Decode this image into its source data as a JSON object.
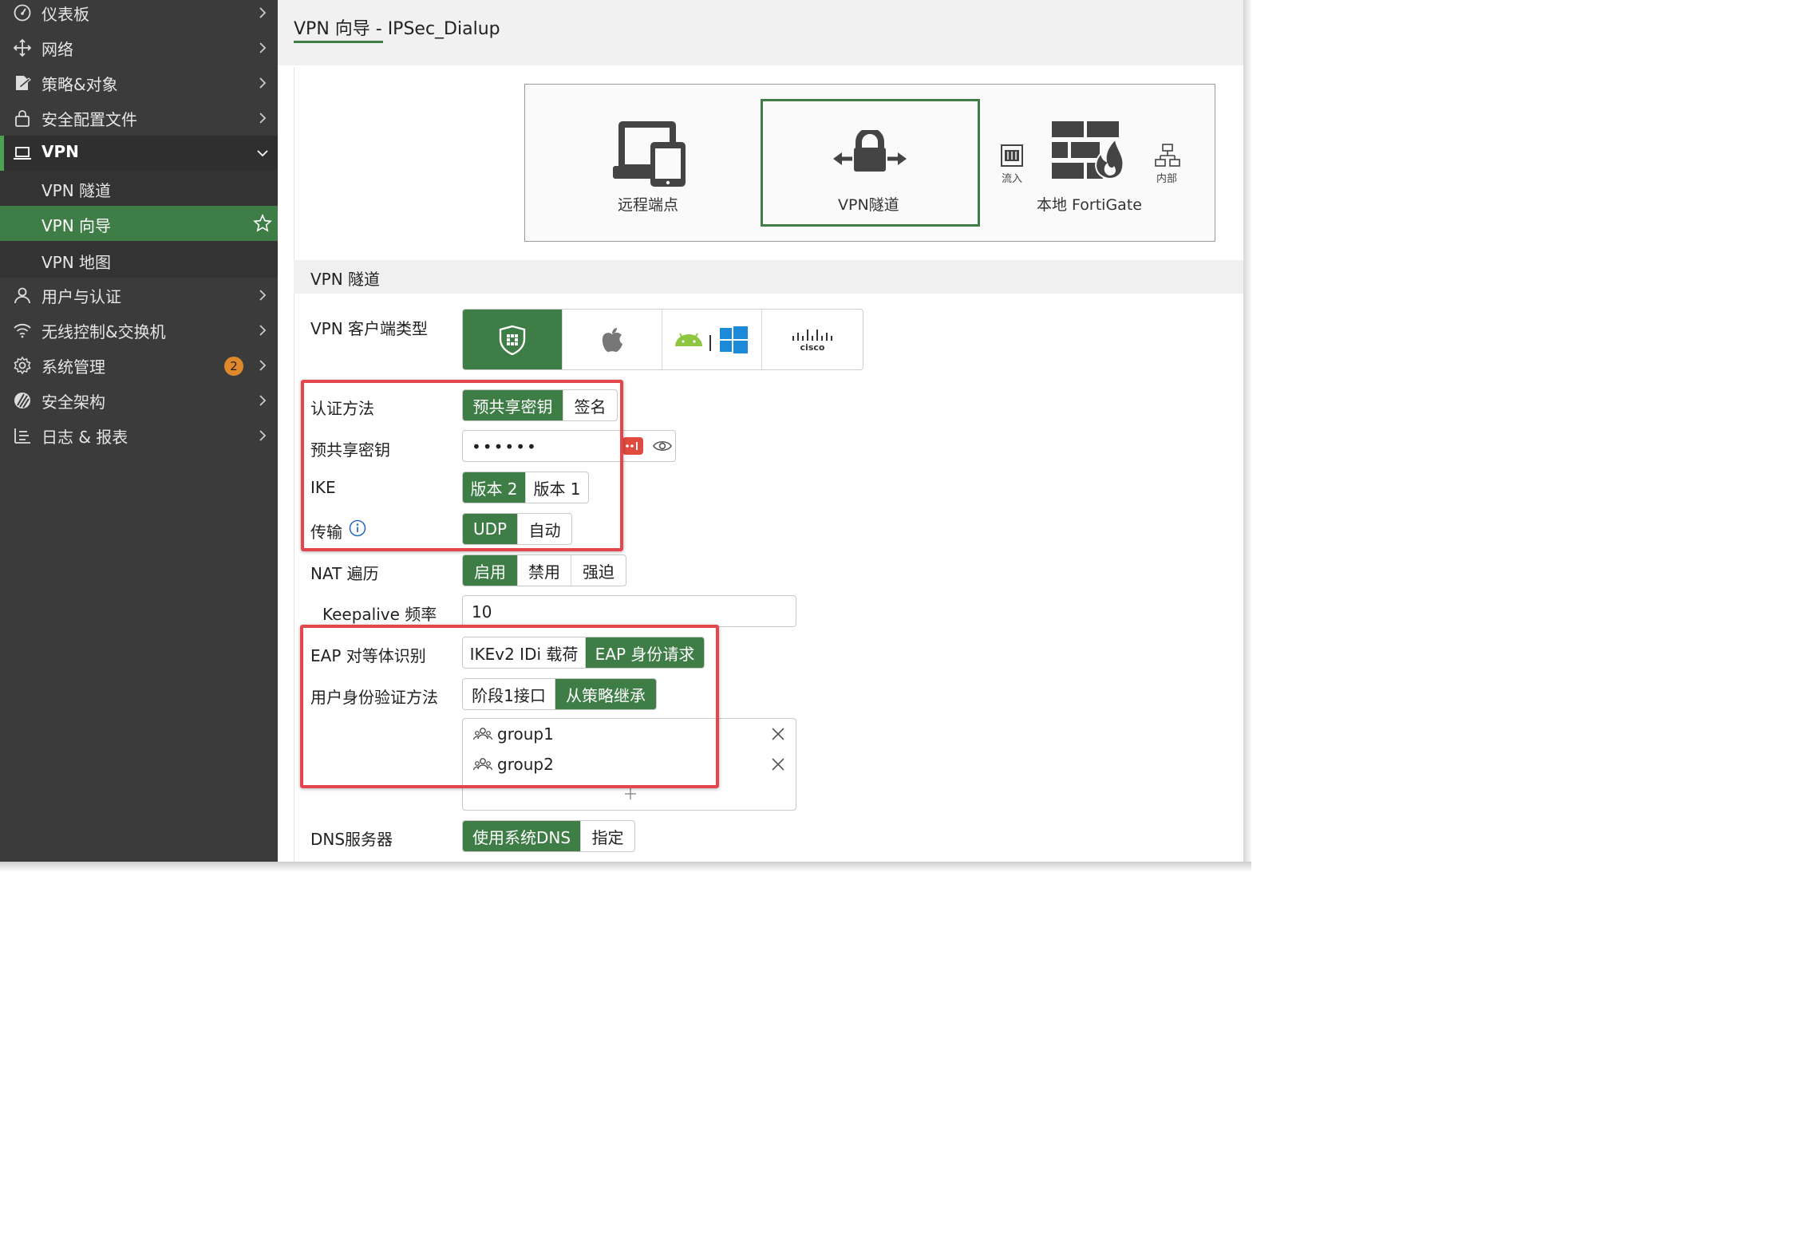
{
  "sidebar": {
    "items": [
      {
        "label": "仪表板",
        "icon": "dashboard-icon"
      },
      {
        "label": "网络",
        "icon": "network-icon"
      },
      {
        "label": "策略&对象",
        "icon": "policy-icon"
      },
      {
        "label": "安全配置文件",
        "icon": "lock-icon"
      },
      {
        "label": "VPN",
        "icon": "laptop-icon"
      },
      {
        "label": "用户与认证",
        "icon": "user-icon"
      },
      {
        "label": "无线控制&交换机",
        "icon": "wifi-icon"
      },
      {
        "label": "系统管理",
        "icon": "gear-icon",
        "badge": "2"
      },
      {
        "label": "安全架构",
        "icon": "security-fabric-icon"
      },
      {
        "label": "日志 & 报表",
        "icon": "log-icon"
      }
    ],
    "vpn_sub": [
      {
        "label": "VPN 隧道"
      },
      {
        "label": "VPN 向导"
      },
      {
        "label": "VPN 地图"
      }
    ]
  },
  "header": {
    "title": "VPN 向导 - IPSec_Dialup"
  },
  "topology": {
    "remote": "远程端点",
    "tunnel": "VPN隧道",
    "local": "本地 FortiGate",
    "inbound": "流入",
    "internal": "内部"
  },
  "section": {
    "title": "VPN 隧道"
  },
  "form": {
    "client_type_label": "VPN 客户端类型",
    "auth_label": "认证方法",
    "auth_options": [
      "预共享密钥",
      "签名"
    ],
    "psk_label": "预共享密钥",
    "psk_value": "••••••",
    "ike_label": "IKE",
    "ike_options": [
      "版本 2",
      "版本 1"
    ],
    "transport_label": "传输",
    "transport_options": [
      "UDP",
      "自动"
    ],
    "nat_label": "NAT 遍历",
    "nat_options": [
      "启用",
      "禁用",
      "强迫"
    ],
    "keepalive_label": "Keepalive 频率",
    "keepalive_value": "10",
    "eap_label": "EAP 对等体识别",
    "eap_options": [
      "IKEv2 IDi 载荷",
      "EAP 身份请求"
    ],
    "user_auth_label": "用户身份验证方法",
    "user_auth_options": [
      "阶段1接口",
      "从策略继承"
    ],
    "groups": [
      "group1",
      "group2"
    ],
    "dns_label": "DNS服务器",
    "dns_options": [
      "使用系统DNS",
      "指定"
    ]
  },
  "colors": {
    "accent": "#3f7d46",
    "highlight": "#e4474b",
    "badge": "#e0892a",
    "sidebar": "#3b3b3b"
  }
}
